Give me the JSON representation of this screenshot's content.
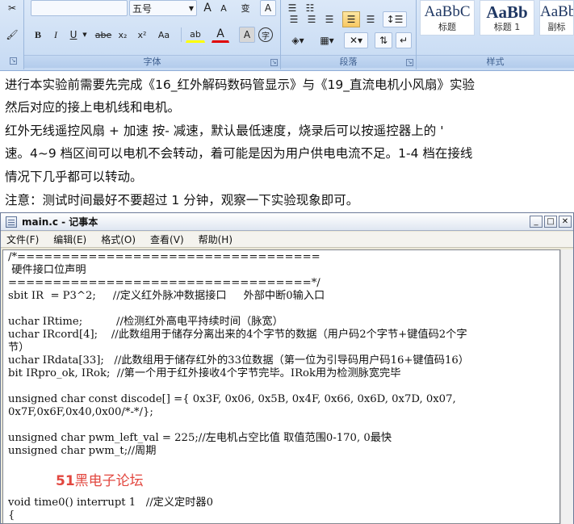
{
  "ribbon": {
    "font_group_label": "字体",
    "paragraph_group_label": "段落",
    "styles_group_label": "样式",
    "font_size_value": "五号",
    "grow_font_label": "A",
    "shrink_font_label": "A",
    "phonetic_label": "变",
    "enclose_label": "A",
    "bold_label": "B",
    "italic_label": "I",
    "underline_label": "U",
    "strikethrough_label": "abe",
    "subscript_label": "x₂",
    "superscript_label": "x²",
    "change_case_label": "Aa",
    "highlight_label": "ab",
    "font_color_label": "A",
    "char_shading_label": "A",
    "enclosed_char_label": "字",
    "styles": [
      {
        "preview": "AaBbC",
        "name": "标题"
      },
      {
        "preview": "AaBb",
        "name": "标题 1"
      },
      {
        "preview": "AaBb",
        "name": "副标"
      }
    ]
  },
  "document": {
    "lines": [
      "进行本实验前需要先完成《16_红外解码数码管显示》与《19_直流电机小风扇》实验",
      "然后对应的接上电机线和电机。",
      "红外无线遥控风扇 +   加速   按- 减速，默认最低速度，烧录后可以按遥控器上的 '",
      "速。4~9 档区间可以电机不会转动，着可能是因为用户供电电流不足。1-4 档在接线",
      "情况下几乎都可以转动。",
      "注意：测试时间最好不要超过 1 分钟，观察一下实验现象即可。"
    ]
  },
  "notepad": {
    "title": "main.c - 记事本",
    "menu": [
      "文件(F)",
      "编辑(E)",
      "格式(O)",
      "查看(V)",
      "帮助(H)"
    ],
    "code_lines": [
      "/*==================================",
      " 硬件接口位声明",
      "==================================*/",
      "sbit IR  = P3^2;     //定义红外脉冲数据接口     外部中断0输入口",
      "",
      "uchar IRtime;          //检测红外高电平持续时间（脉宽）",
      "uchar IRcord[4];    //此数组用于储存分离出来的4个字节的数据（用户码2个字节+键值码2个字",
      "节）",
      "uchar IRdata[33];   //此数组用于储存红外的33位数据（第一位为引导码用户码16+键值码16）",
      "bit IRpro_ok, IRok;  //第一个用于红外接收4个字节完毕。IRok用为检测脉宽完毕",
      "",
      "unsigned char const discode[] ={ 0x3F, 0x06, 0x5B, 0x4F, 0x66, 0x6D, 0x7D, 0x07,",
      "0x7F,0x6F,0x40,0x00/*-*/};",
      "",
      "unsigned char pwm_left_val = 225;//左电机占空比值 取值范围0-170, 0最快",
      "unsigned char pwm_t;//周期",
      "",
      "",
      "",
      "void time0() interrupt 1   //定义定时器0",
      "{"
    ],
    "watermark_prefix": "51",
    "watermark_text": "黑电子论坛"
  }
}
